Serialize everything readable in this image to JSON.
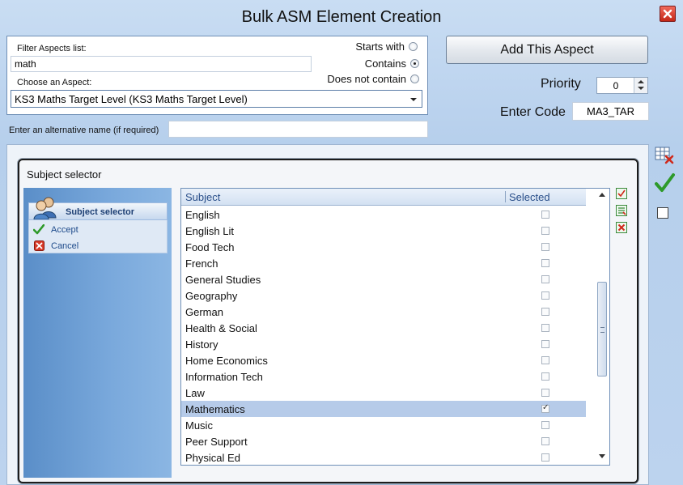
{
  "window": {
    "title": "Bulk ASM Element Creation"
  },
  "filter": {
    "label": "Filter Aspects list:",
    "value": "math",
    "options": [
      {
        "label": "Starts with",
        "selected": false
      },
      {
        "label": "Contains",
        "selected": true
      },
      {
        "label": "Does not contain",
        "selected": false
      }
    ]
  },
  "aspect": {
    "label": "Choose an Aspect:",
    "selected": "KS3 Maths Target Level (KS3 Maths Target Level)"
  },
  "alt_name": {
    "label": "Enter an alternative name (if required)",
    "value": ""
  },
  "actions": {
    "add_label": "Add This Aspect"
  },
  "priority": {
    "label": "Priority",
    "value": "0"
  },
  "code": {
    "label": "Enter Code",
    "value": "MA3_TAR"
  },
  "subject_dialog": {
    "title": "Subject selector",
    "task_title": "Subject selector",
    "accept_label": "Accept",
    "cancel_label": "Cancel",
    "columns": [
      "Subject",
      "Selected"
    ],
    "rows": [
      {
        "subject": "English",
        "selected": false
      },
      {
        "subject": "English Lit",
        "selected": false
      },
      {
        "subject": "Food Tech",
        "selected": false
      },
      {
        "subject": "French",
        "selected": false
      },
      {
        "subject": "General Studies",
        "selected": false
      },
      {
        "subject": "Geography",
        "selected": false
      },
      {
        "subject": "German",
        "selected": false
      },
      {
        "subject": "Health & Social",
        "selected": false
      },
      {
        "subject": "History",
        "selected": false
      },
      {
        "subject": "Home Economics",
        "selected": false
      },
      {
        "subject": "Information Tech",
        "selected": false
      },
      {
        "subject": "Law",
        "selected": false
      },
      {
        "subject": "Mathematics",
        "selected": true
      },
      {
        "subject": "Music",
        "selected": false
      },
      {
        "subject": "Peer Support",
        "selected": false
      },
      {
        "subject": "Physical Ed",
        "selected": false
      }
    ],
    "highlighted_row": 12
  },
  "colors": {
    "background": "#bcd3ee",
    "accent": "#2a4f8a",
    "selection": "#b6cbe9",
    "close_red": "#d83a28",
    "check_green": "#2e9a2a"
  }
}
